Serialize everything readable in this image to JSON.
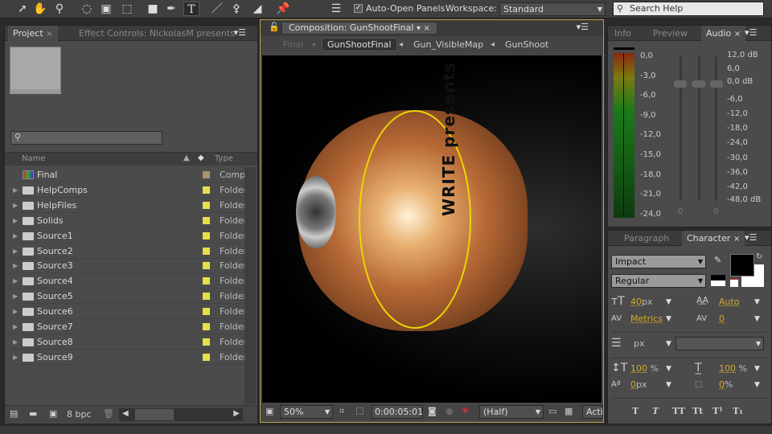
{
  "toolbar": {
    "auto_open_label": "Auto-Open Panels",
    "workspace_label": "Workspace:",
    "workspace_value": "Standard",
    "search_placeholder": "Search Help",
    "tools": [
      "selection-tool",
      "hand-tool",
      "zoom-tool",
      "rotate-tool",
      "camera-tool",
      "pan-behind-tool",
      "rectangle-tool",
      "pen-tool",
      "type-tool",
      "brush-tool",
      "clone-stamp-tool",
      "eraser-tool",
      "puppet-pin-tool"
    ]
  },
  "project": {
    "tabs": [
      "Project",
      "Effect Controls: NickolasM presents"
    ],
    "columns": {
      "name": "Name",
      "type": "Type"
    },
    "items": [
      {
        "name": "Final",
        "type": "Compo",
        "kind": "comp",
        "label_color": "#a89470"
      },
      {
        "name": "HelpComps",
        "type": "Folder",
        "kind": "folder",
        "label_color": "#e6e04a"
      },
      {
        "name": "HelpFiles",
        "type": "Folder",
        "kind": "folder",
        "label_color": "#e6e04a"
      },
      {
        "name": "Solids",
        "type": "Folder",
        "kind": "folder",
        "label_color": "#e6e04a"
      },
      {
        "name": "Source1",
        "type": "Folder",
        "kind": "folder",
        "label_color": "#e6e04a"
      },
      {
        "name": "Source2",
        "type": "Folder",
        "kind": "folder",
        "label_color": "#e6e04a"
      },
      {
        "name": "Source3",
        "type": "Folder",
        "kind": "folder",
        "label_color": "#e6e04a"
      },
      {
        "name": "Source4",
        "type": "Folder",
        "kind": "folder",
        "label_color": "#e6e04a"
      },
      {
        "name": "Source5",
        "type": "Folder",
        "kind": "folder",
        "label_color": "#e6e04a"
      },
      {
        "name": "Source6",
        "type": "Folder",
        "kind": "folder",
        "label_color": "#e6e04a"
      },
      {
        "name": "Source7",
        "type": "Folder",
        "kind": "folder",
        "label_color": "#e6e04a"
      },
      {
        "name": "Source8",
        "type": "Folder",
        "kind": "folder",
        "label_color": "#e6e04a"
      },
      {
        "name": "Source9",
        "type": "Folder",
        "kind": "folder",
        "label_color": "#e6e04a"
      }
    ],
    "bpc": "8 bpc"
  },
  "composition": {
    "tab": "Composition: GunShootFinal",
    "breadcrumbs": [
      "Final",
      "GunShootFinal",
      "Gun_VisibleMap",
      "GunShoot"
    ],
    "zoom": "50%",
    "timecode": "0:00:05:01",
    "resolution": "(Half)",
    "active_camera": "Acti",
    "viewer_text": "WRITE presents"
  },
  "audio": {
    "tabs": [
      "Info",
      "Preview",
      "Audio"
    ],
    "meter_scale": [
      "0,0",
      "-3,0",
      "-6,0",
      "-9,0",
      "-12,0",
      "-15,0",
      "-18,0",
      "-21,0",
      "-24,0"
    ],
    "db_scale": [
      "12,0 dB",
      "6,0",
      "0,0 dB",
      "-6,0",
      "-12,0",
      "-18,0",
      "-24,0",
      "-30,0",
      "-36,0",
      "-42,0",
      "-48,0 dB"
    ],
    "left_value": "0",
    "right_value": "0"
  },
  "character": {
    "tabs": [
      "Paragraph",
      "Character"
    ],
    "font": "Impact",
    "style": "Regular",
    "font_size": "40",
    "font_size_unit": "px",
    "leading": "Auto",
    "kerning": "Metrics",
    "tracking": "0",
    "stroke_unit": "px",
    "vscale": "100",
    "hscale": "100",
    "pct": "%",
    "baseline": "0",
    "baseline_unit": "px",
    "tsume": "0",
    "styles": [
      "T",
      "T",
      "TT",
      "Tt",
      "T¹",
      "T₁"
    ],
    "fill_color": "#000000",
    "stroke_color": "#ffffff"
  }
}
